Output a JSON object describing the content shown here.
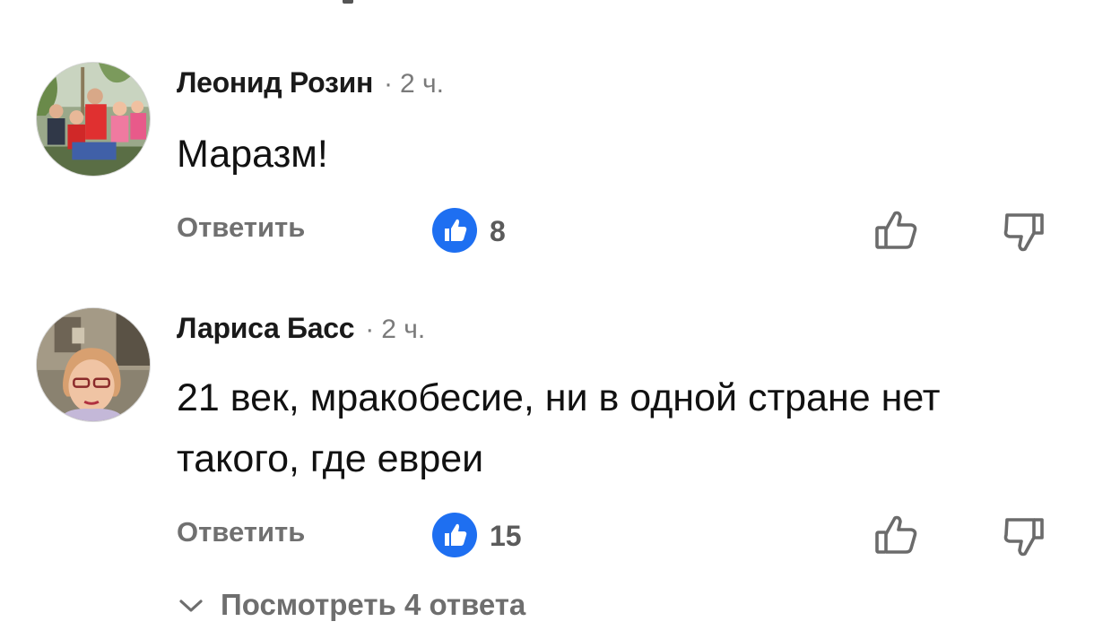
{
  "comments": [
    {
      "author": "Леонид Розин",
      "separator": "·",
      "time": "2 ч.",
      "text": "Маразм!",
      "reply_label": "Ответить",
      "likes": "8",
      "avatar_icon": "user-photo-avatar"
    },
    {
      "author": "Лариса Басс",
      "separator": "·",
      "time": "2 ч.",
      "text": "21 век, мракобесие, ни в одной стране нет такого, где евреи",
      "reply_label": "Ответить",
      "likes": "15",
      "avatar_icon": "user-photo-avatar"
    }
  ],
  "view_replies": {
    "label": "Посмотреть 4 ответа",
    "icon": "chevron-down-icon"
  },
  "colors": {
    "like_badge": "#1e6ff1",
    "muted_text": "#707070",
    "text": "#111111"
  }
}
